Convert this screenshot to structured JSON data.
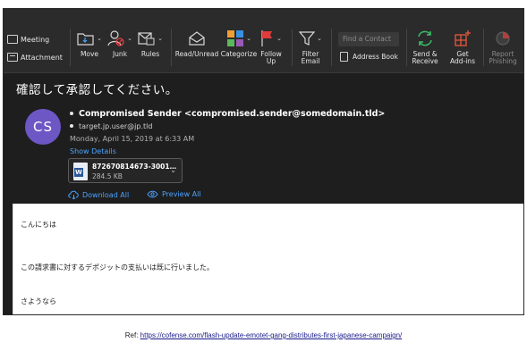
{
  "toolbar": {
    "meeting": "Meeting",
    "attachment": "Attachment",
    "move": "Move",
    "junk": "Junk",
    "rules": "Rules",
    "read_unread": "Read/Unread",
    "categorize": "Categorize",
    "follow_up_1": "Follow",
    "follow_up_2": "Up",
    "filter_1": "Filter",
    "filter_2": "Email",
    "find_contact_placeholder": "Find a Contact",
    "address_book": "Address Book",
    "send_receive_1": "Send &",
    "send_receive_2": "Receive",
    "get_addins_1": "Get",
    "get_addins_2": "Add-ins",
    "report_1": "Report",
    "report_2": "Phishing"
  },
  "message": {
    "subject": "確認して承認してください。",
    "avatar_initials": "CS",
    "from": "Compromised Sender <compromised.sender@somedomain.tld>",
    "to": "target.jp.user@jp.tld",
    "date": "Monday, April 15, 2019 at 6:33 AM",
    "show_details": "Show Details",
    "attachment_name": "872670814673-3001…",
    "attachment_size": "284.5 KB",
    "download_all": "Download All",
    "preview_all": "Preview All",
    "body_lines": [
      "こんにちは",
      "この請求書に対するデポジットの支払いは既に行いました。",
      "さようなら"
    ]
  },
  "reference": {
    "prefix": "Ref: ",
    "url": "https://cofense.com/flash-update-emotet-gang-distributes-first-japanese-campaign/"
  },
  "colors": {
    "avatar": "#6d57c4",
    "link": "#4aa3ff",
    "window_bg": "#1e1e1e",
    "toolbar_bg": "#2b2b2b"
  }
}
